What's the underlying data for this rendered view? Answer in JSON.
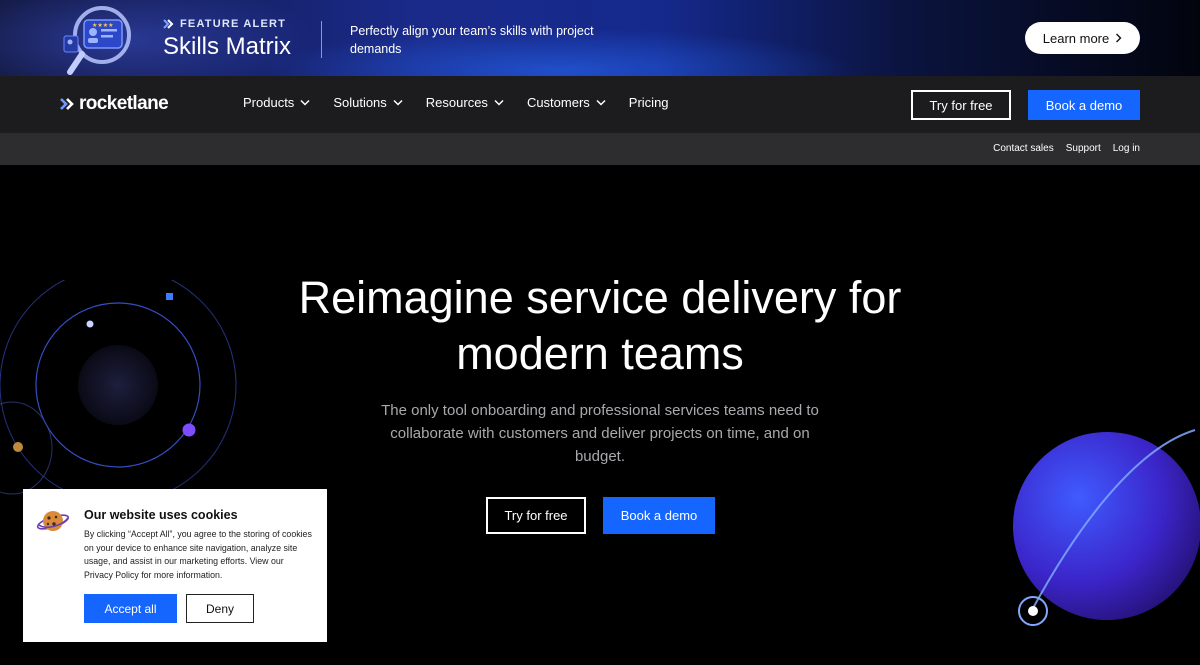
{
  "banner": {
    "tag": "FEATURE ALERT",
    "title": "Skills Matrix",
    "description": "Perfectly align your team’s skills with project demands",
    "cta_label": "Learn more"
  },
  "nav": {
    "logo_text": "rocketlane",
    "items": [
      {
        "label": "Products",
        "has_dropdown": true
      },
      {
        "label": "Solutions",
        "has_dropdown": true
      },
      {
        "label": "Resources",
        "has_dropdown": true
      },
      {
        "label": "Customers",
        "has_dropdown": true
      },
      {
        "label": "Pricing",
        "has_dropdown": false
      }
    ],
    "try_label": "Try for free",
    "demo_label": "Book a demo"
  },
  "subnav": {
    "links": [
      "Contact sales",
      "Support",
      "Log in"
    ]
  },
  "hero": {
    "title_line1": "Reimagine service delivery for",
    "title_line2": "modern teams",
    "subtitle": "The only tool onboarding and professional services teams need to collaborate with customers and deliver projects on time, and on budget.",
    "try_label": "Try for free",
    "demo_label": "Book a demo"
  },
  "cookie": {
    "title": "Our website uses cookies",
    "text": "By clicking “Accept All”, you agree to the storing of cookies on your device to enhance site navigation, analyze site usage, and assist in our marketing efforts. View our Privacy Policy for more information.",
    "accept_label": "Accept all",
    "deny_label": "Deny"
  },
  "colors": {
    "accent_blue": "#1565ff",
    "nav_bg": "#1c1c1f",
    "subnav_bg": "#2d2d30",
    "page_bg": "#000000"
  },
  "icons": {
    "banner_art": "magnifier-profile-card-icon",
    "logo_mark": "double-chevron-icon",
    "dropdown": "chevron-down-icon",
    "cta_arrow": "chevron-right-icon",
    "cookie": "cookie-icon"
  }
}
